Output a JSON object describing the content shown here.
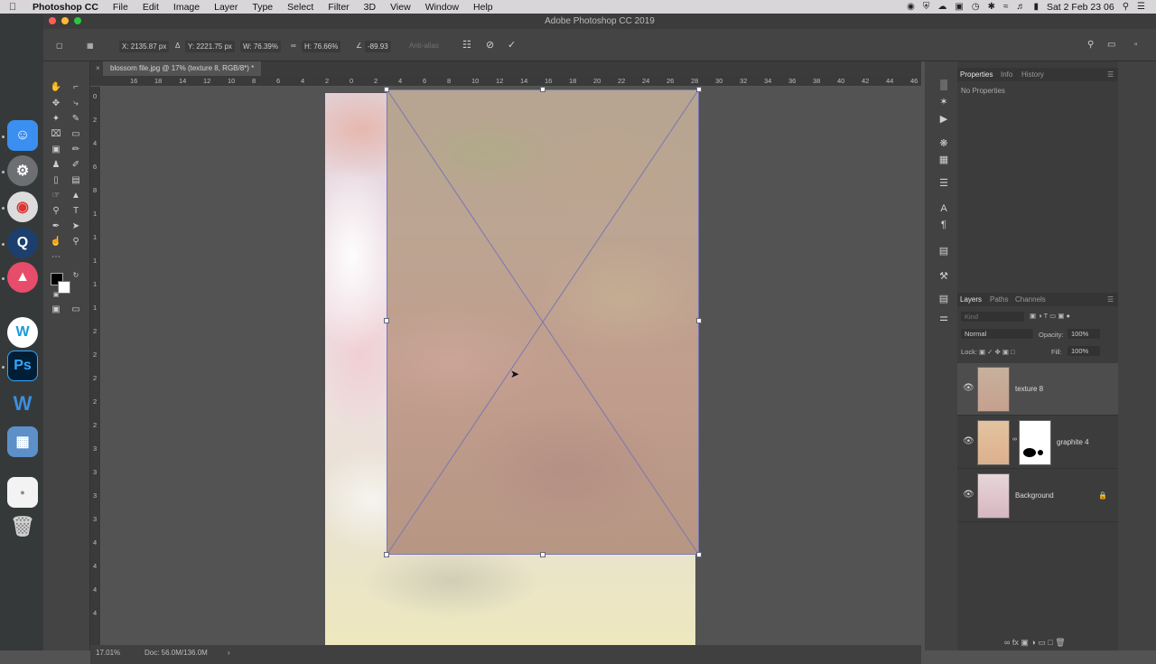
{
  "menubar": {
    "app_name": "Photoshop CC",
    "items": [
      "File",
      "Edit",
      "Image",
      "Layer",
      "Type",
      "Select",
      "Filter",
      "3D",
      "View",
      "Window",
      "Help"
    ],
    "clock": "Sat 2 Feb  23 06"
  },
  "window": {
    "title": "Adobe Photoshop CC 2019"
  },
  "options": {
    "x": "X: 2135.87 px",
    "y": "Y: 2221.75 px",
    "w": "W: 76.39%",
    "h": "H: 76.66%",
    "angle": "-89.93",
    "anti_alias": "Anti-alias"
  },
  "document": {
    "tab": "blossom file.jpg @ 17% (texture 8, RGB/8*) *",
    "zoom": "17.01%",
    "doc_info": "Doc: 56.0M/136.0M"
  },
  "ruler": {
    "top": [
      "16",
      "18",
      "14",
      "12",
      "10",
      "8",
      "6",
      "4",
      "2",
      "0",
      "2",
      "4",
      "6",
      "8",
      "10",
      "12",
      "14",
      "16",
      "18",
      "20",
      "22",
      "24",
      "26",
      "28",
      "30",
      "32",
      "34",
      "36",
      "38",
      "40",
      "42",
      "44",
      "46"
    ],
    "left": [
      "0",
      "2",
      "4",
      "6",
      "8",
      "1",
      "1",
      "1",
      "1",
      "1",
      "2",
      "2",
      "2",
      "2",
      "2",
      "3",
      "3",
      "3",
      "3",
      "4",
      "4",
      "4",
      "4"
    ]
  },
  "properties_panel": {
    "tabs": [
      "Properties",
      "Info",
      "History"
    ],
    "empty_text": "No Properties"
  },
  "layers_panel": {
    "tabs": [
      "Layers",
      "Paths",
      "Channels"
    ],
    "kind_placeholder": "Kind",
    "blend_mode": "Normal",
    "opacity_label": "Opacity:",
    "opacity_value": "100%",
    "lock_label": "Lock:",
    "fill_label": "Fill:",
    "fill_value": "100%",
    "layers": [
      {
        "name": "texture 8"
      },
      {
        "name": "graphite 4"
      },
      {
        "name": "Background"
      }
    ]
  },
  "colors": {
    "transform_box": "#7a78b0",
    "chrome_dark": "#3c3c3c",
    "canvas_bg": "#535353"
  }
}
